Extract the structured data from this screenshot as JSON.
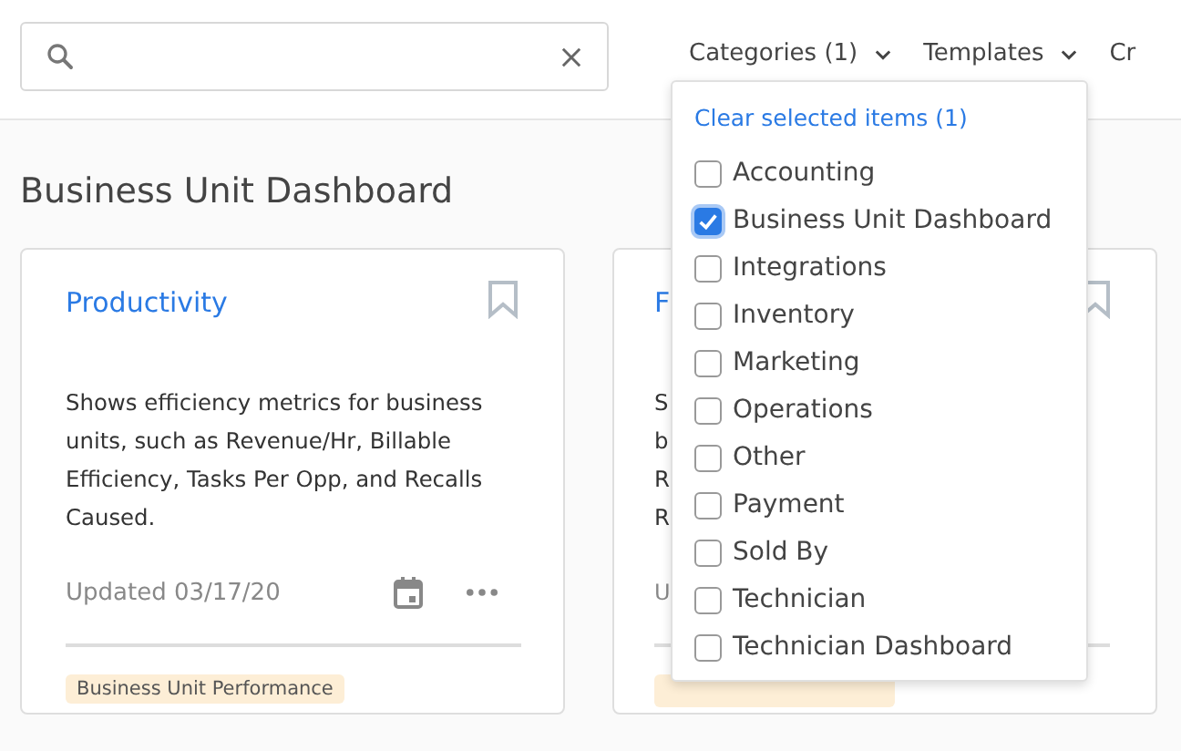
{
  "nav": [
    {
      "label": "Categories (1)",
      "has_caret": true
    },
    {
      "label": "Templates",
      "has_caret": true
    },
    {
      "label": "Cr",
      "has_caret": false
    }
  ],
  "heading": "Business Unit Dashboard",
  "cards": [
    {
      "title": "Productivity",
      "description": "Shows efficiency metrics for business units, such as Revenue/Hr, Billable Efficiency, Tasks Per Opp, and Recalls Caused.",
      "updated": "Updated 03/17/20",
      "tag": "Business Unit Performance"
    },
    {
      "title": "F",
      "description_lines": [
        "S",
        "b",
        "R",
        "R"
      ],
      "updated": "U"
    }
  ],
  "dropdown": {
    "clear_link": "Clear selected items (1)",
    "items": [
      {
        "label": "Accounting",
        "checked": false
      },
      {
        "label": "Business Unit Dashboard",
        "checked": true
      },
      {
        "label": "Integrations",
        "checked": false
      },
      {
        "label": "Inventory",
        "checked": false
      },
      {
        "label": "Marketing",
        "checked": false
      },
      {
        "label": "Operations",
        "checked": false
      },
      {
        "label": "Other",
        "checked": false
      },
      {
        "label": "Payment",
        "checked": false
      },
      {
        "label": "Sold By",
        "checked": false
      },
      {
        "label": "Technician",
        "checked": false
      },
      {
        "label": "Technician Dashboard",
        "checked": false
      }
    ]
  }
}
